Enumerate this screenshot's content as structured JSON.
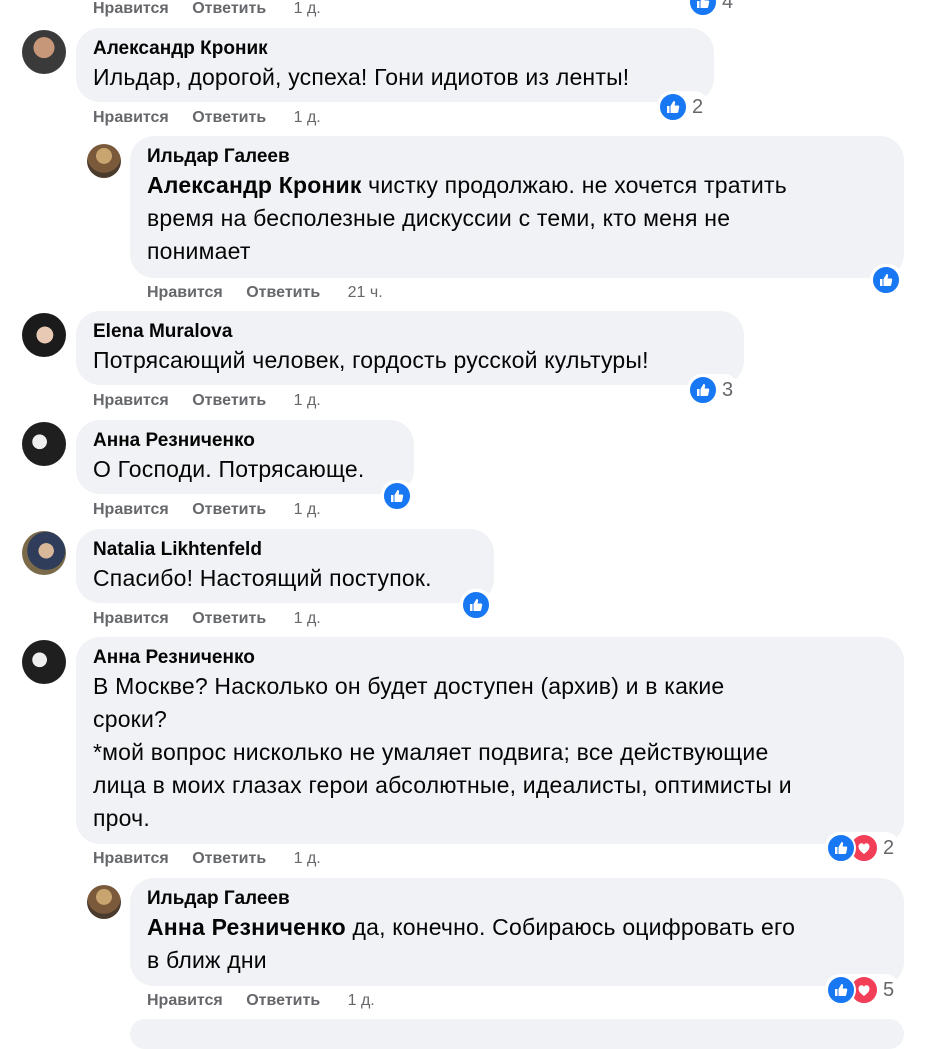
{
  "labels": {
    "like": "Нравится",
    "reply": "Ответить"
  },
  "colors": {
    "like_blue": "#1877f2",
    "love_red": "#f33e58",
    "bubble_bg": "#f0f2f5",
    "meta_gray": "#65676b"
  },
  "top_meta": {
    "time": "1 д.",
    "reactions_count": "4"
  },
  "comments": [
    {
      "author": "Александр Кроник",
      "lines": [
        "Ильдар, дорогой, успеха! Гони идиотов из ленты!"
      ],
      "time": "1 д.",
      "reactions": [
        "like-icon"
      ],
      "reactions_count": "2",
      "reply": {
        "author": "Ильдар Галеев",
        "mention": "Александр Кроник",
        "lines": [
          " чистку продолжаю. не хочется тратить",
          "время на бесполезные дискуссии с теми, кто меня не",
          "понимает"
        ],
        "time": "21 ч.",
        "reactions": [
          "like-icon"
        ],
        "reactions_count": ""
      }
    },
    {
      "author": "Elena Muralova",
      "lines": [
        "Потрясающий человек, гордость русской культуры!"
      ],
      "time": "1 д.",
      "reactions": [
        "like-icon"
      ],
      "reactions_count": "3"
    },
    {
      "author": "Анна Резниченко",
      "lines": [
        "О Господи. Потрясающе."
      ],
      "time": "1 д.",
      "reactions": [
        "like-icon"
      ],
      "reactions_count": ""
    },
    {
      "author": "Natalia Likhtenfeld",
      "lines": [
        "Спасибо! Настоящий поступок."
      ],
      "time": "1 д.",
      "reactions": [
        "like-icon"
      ],
      "reactions_count": ""
    },
    {
      "author": "Анна Резниченко",
      "lines": [
        "В Москве? Насколько он будет доступен (архив) и в какие",
        "сроки?",
        "*мой вопрос нисколько не умаляет подвига; все действующие",
        "лица в моих глазах герои абсолютные, идеалисты, оптимисты и",
        "проч."
      ],
      "time": "1 д.",
      "reactions": [
        "like-icon",
        "love-icon"
      ],
      "reactions_count": "2",
      "reply": {
        "author": "Ильдар Галеев",
        "mention": "Анна Резниченко",
        "lines": [
          " да, конечно. Собираюсь оцифровать его",
          "в ближ дни"
        ],
        "time": "1 д.",
        "reactions": [
          "like-icon",
          "love-icon"
        ],
        "reactions_count": "5"
      }
    }
  ]
}
